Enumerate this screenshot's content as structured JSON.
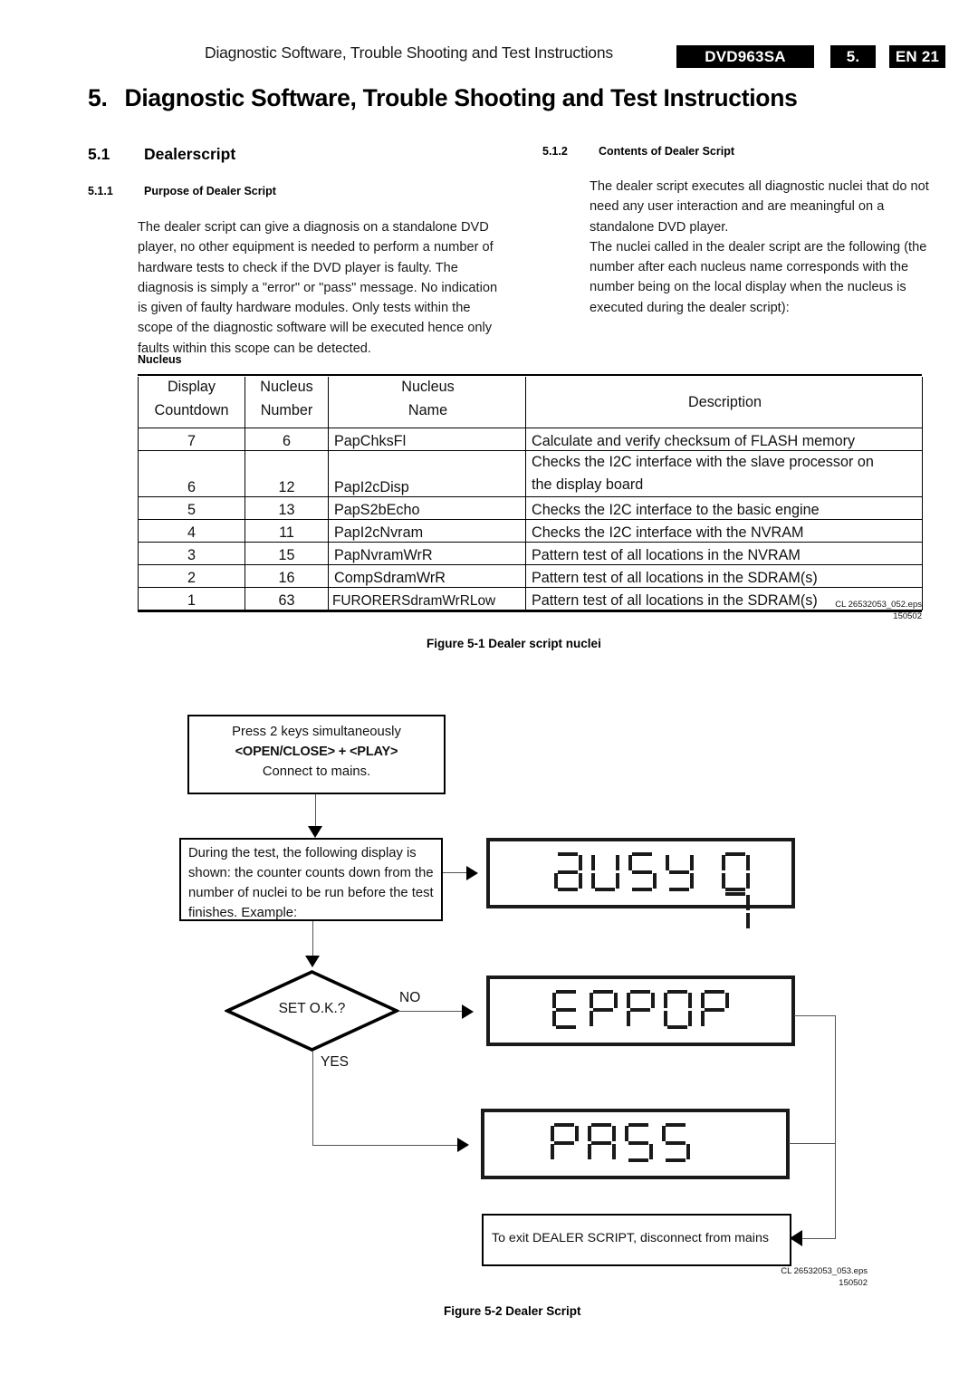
{
  "header": {
    "running_title": "Diagnostic Software, Trouble Shooting and Test Instructions",
    "model_badge": "DVD963SA",
    "chapter_badge": "5.",
    "page_badge": "EN 21"
  },
  "chapter": {
    "number": "5.",
    "title": "Diagnostic Software, Trouble Shooting and Test Instructions"
  },
  "sections": {
    "s51_num": "5.1",
    "s51_title": "Dealerscript",
    "s511_num": "5.1.1",
    "s511_title": "Purpose of Dealer Script",
    "s511_body": "The dealer script can give a diagnosis on a standalone DVD player, no other equipment is needed to perform a number of hardware tests to check if the DVD player is faulty. The diagnosis is simply a \"error\" or \"pass\" message. No indication is given of faulty hardware modules. Only tests within the scope of the diagnostic software will be executed hence only faults within this scope can be detected.",
    "s512_num": "5.1.2",
    "s512_title": "Contents of Dealer Script",
    "s512_body_p1": "The dealer script executes all diagnostic nuclei that do not need any user interaction and are meaningful on a standalone DVD player.",
    "s512_body_p2": "The nuclei called in the dealer script are the following (the number after each nucleus name corresponds with the number being on the local display when the nucleus is executed during the dealer script):"
  },
  "table": {
    "label": "Nucleus",
    "headers": {
      "col1_line1": "Display",
      "col1_line2": "Countdown",
      "col2_line1": "Nucleus",
      "col2_line2": "Number",
      "col3_line1": "Nucleus",
      "col3_line2": "Name",
      "col4_line1": "Description",
      "col4_line2": ""
    },
    "rows": [
      {
        "countdown": "7",
        "number": "6",
        "name": "PapChksFl",
        "desc_line1": "Calculate and verify checksum of FLASH memory",
        "desc_line2": ""
      },
      {
        "countdown": "6",
        "number": "12",
        "name": "PapI2cDisp",
        "desc_line1": "Checks the I2C interface with the slave processor on",
        "desc_line2": "the display board"
      },
      {
        "countdown": "5",
        "number": "13",
        "name": "PapS2bEcho",
        "desc_line1": "Checks the I2C interface to the basic engine",
        "desc_line2": ""
      },
      {
        "countdown": "4",
        "number": "11",
        "name": "PapI2cNvram",
        "desc_line1": "Checks the I2C interface with the NVRAM",
        "desc_line2": ""
      },
      {
        "countdown": "3",
        "number": "15",
        "name": "PapNvramWrR",
        "desc_line1": "Pattern test of all locations in the NVRAM",
        "desc_line2": ""
      },
      {
        "countdown": "2",
        "number": "16",
        "name": "CompSdramWrR",
        "desc_line1": "Pattern test of all locations in the SDRAM(s)",
        "desc_line2": ""
      },
      {
        "countdown": "1",
        "number": "63",
        "name": "FURORERSdramWrRLow",
        "desc_line1": "Pattern test of all locations in the SDRAM(s)",
        "desc_line2": ""
      }
    ]
  },
  "figure1": {
    "eps_id": "CL 26532053_052.eps",
    "eps_date": "150502",
    "caption": "Figure 5-1 Dealer script nuclei"
  },
  "figure2": {
    "eps_id": "CL 26532053_053.eps",
    "eps_date": "150502",
    "caption": "Figure 5-2 Dealer Script"
  },
  "flowchart": {
    "start_line1": "Press 2 keys simultaneously",
    "start_line2": "<OPEN/CLOSE> + <PLAY>",
    "start_line3": "Connect to mains.",
    "during_text": "During the test, the following display is shown: the counter counts down from the number of nuclei to be run before the test finishes. Example:",
    "decision_label": "SET O.K.?",
    "branch_no": "NO",
    "branch_yes": "YES",
    "exit_text": "To exit DEALER SCRIPT, disconnect from mains",
    "display_busy_text": "BUSY",
    "display_busy_counter": "07",
    "display_error_text": "ERROR",
    "display_pass_text": "PASS"
  }
}
